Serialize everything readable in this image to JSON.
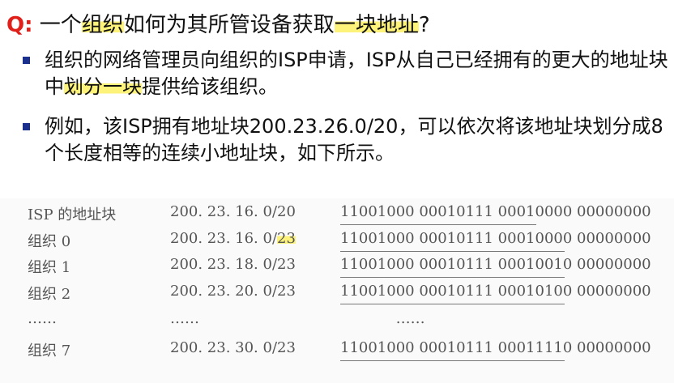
{
  "title": {
    "prefix": "Q:",
    "parts": [
      "一个",
      "组织",
      "如何为其所管设备获取",
      "一块地址",
      "?"
    ]
  },
  "bullets": [
    {
      "parts": [
        "组织的网络管理员向组织的ISP申请，ISP从自己已经拥有的更大的地址块中",
        "划分一块",
        "提供给该组织。"
      ]
    },
    {
      "parts": [
        "例如，该ISP拥有地址块200.23.26.0/20，可以依次将该地址块划分成8个长度相等的连续小地址块，如下所示。"
      ]
    }
  ],
  "table": {
    "rows": [
      {
        "name": "ISP 的地址块",
        "prefix": "200. 23. 16. 0/",
        "len": "20",
        "bits": "11001000 00010111 00010000 00000000",
        "prefix_bits": 20
      },
      {
        "name": "组织 0",
        "prefix": "200. 23. 16. 0/",
        "len": "23",
        "bits": "11001000 00010111 00010000 00000000",
        "prefix_bits": 23
      },
      {
        "name": "组织 1",
        "prefix": "200. 23. 18. 0/",
        "len": "23",
        "bits": "11001000 00010111 00010010 00000000",
        "prefix_bits": 23
      },
      {
        "name": "组织 2",
        "prefix": "200. 23. 20. 0/",
        "len": "23",
        "bits": "11001000 00010111 00010100 00000000",
        "prefix_bits": 23
      },
      {
        "name": "……",
        "prefix": "……",
        "len": "",
        "bits": "            ……",
        "prefix_bits": 0
      },
      {
        "name": "组织 7",
        "prefix": "200. 23. 30. 0/",
        "len": "23",
        "bits": "11001000 00010111 00011110 00000000",
        "prefix_bits": 23
      }
    ]
  }
}
